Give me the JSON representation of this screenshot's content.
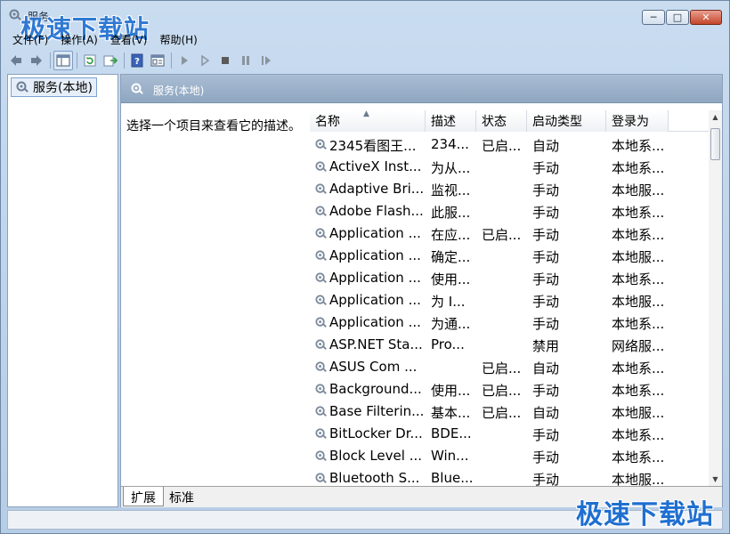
{
  "window": {
    "title": "服务"
  },
  "watermark": "极速下载站",
  "caption": {
    "minimize": "─",
    "maximize": "□",
    "close": "✕"
  },
  "menu": [
    "文件(F)",
    "操作(A)",
    "查看(V)",
    "帮助(H)"
  ],
  "toolbar": [
    "back-icon",
    "forward-icon",
    "show-tree-icon",
    "refresh-icon",
    "export-icon",
    "help-icon",
    "properties-icon",
    "start-icon",
    "start-alt-icon",
    "stop-icon",
    "pause-icon",
    "resume-icon"
  ],
  "tree": {
    "root": "服务(本地)"
  },
  "right_pane": {
    "header": "服务(本地)",
    "description": "选择一个项目来查看它的描述。"
  },
  "columns": [
    "名称",
    "描述",
    "状态",
    "启动类型",
    "登录为"
  ],
  "rows": [
    {
      "name": "2345看图王...",
      "desc": "234...",
      "status": "已启...",
      "startup": "自动",
      "logon": "本地系..."
    },
    {
      "name": "ActiveX Inst...",
      "desc": "为从...",
      "status": "",
      "startup": "手动",
      "logon": "本地系..."
    },
    {
      "name": "Adaptive Bri...",
      "desc": "监视...",
      "status": "",
      "startup": "手动",
      "logon": "本地服..."
    },
    {
      "name": "Adobe Flash...",
      "desc": "此服...",
      "status": "",
      "startup": "手动",
      "logon": "本地系..."
    },
    {
      "name": "Application ...",
      "desc": "在应...",
      "status": "已启...",
      "startup": "手动",
      "logon": "本地系..."
    },
    {
      "name": "Application ...",
      "desc": "确定...",
      "status": "",
      "startup": "手动",
      "logon": "本地服..."
    },
    {
      "name": "Application ...",
      "desc": "使用...",
      "status": "",
      "startup": "手动",
      "logon": "本地系..."
    },
    {
      "name": "Application ...",
      "desc": "为 I...",
      "status": "",
      "startup": "手动",
      "logon": "本地服..."
    },
    {
      "name": "Application ...",
      "desc": "为通...",
      "status": "",
      "startup": "手动",
      "logon": "本地系..."
    },
    {
      "name": "ASP.NET Sta...",
      "desc": "Pro...",
      "status": "",
      "startup": "禁用",
      "logon": "网络服..."
    },
    {
      "name": "ASUS Com ...",
      "desc": "",
      "status": "已启...",
      "startup": "自动",
      "logon": "本地系..."
    },
    {
      "name": "Background...",
      "desc": "使用...",
      "status": "已启...",
      "startup": "手动",
      "logon": "本地系..."
    },
    {
      "name": "Base Filterin...",
      "desc": "基本...",
      "status": "已启...",
      "startup": "自动",
      "logon": "本地服..."
    },
    {
      "name": "BitLocker Dr...",
      "desc": "BDE...",
      "status": "",
      "startup": "手动",
      "logon": "本地系..."
    },
    {
      "name": "Block Level ...",
      "desc": "Win...",
      "status": "",
      "startup": "手动",
      "logon": "本地系..."
    },
    {
      "name": "Bluetooth S...",
      "desc": "Blue...",
      "status": "",
      "startup": "手动",
      "logon": "本地服..."
    }
  ],
  "tabs": [
    "扩展",
    "标准"
  ],
  "colors": {
    "accent": "#1f6fd0",
    "header_blue": "#8fa6c0"
  }
}
